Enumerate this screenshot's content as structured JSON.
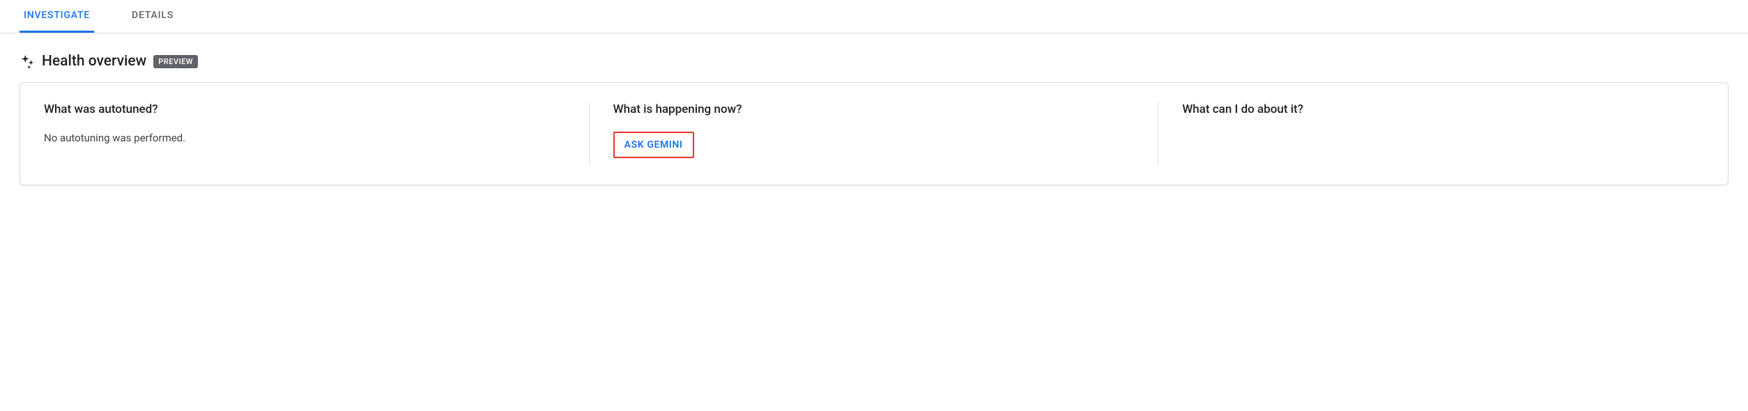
{
  "tabs": {
    "investigate": "INVESTIGATE",
    "details": "DETAILS"
  },
  "section": {
    "title": "Health overview",
    "badge": "PREVIEW"
  },
  "columns": {
    "autotuned": {
      "title": "What was autotuned?",
      "body": "No autotuning was performed."
    },
    "happening": {
      "title": "What is happening now?",
      "ask_label": "ASK GEMINI"
    },
    "action": {
      "title": "What can I do about it?"
    }
  }
}
